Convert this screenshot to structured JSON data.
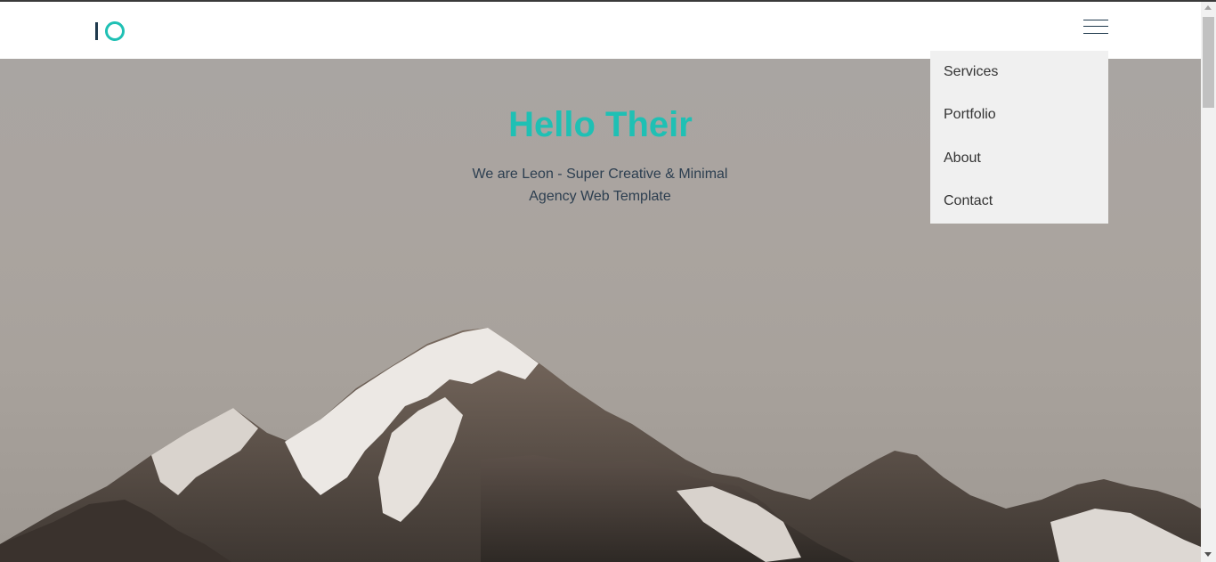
{
  "brand": {
    "logo_icon": "io-logo",
    "bar_color": "#1f3a4d",
    "ring_color": "#1fc0b4"
  },
  "nav": {
    "menu_icon": "hamburger-menu-icon",
    "items": [
      {
        "label": "Services"
      },
      {
        "label": "Portfolio"
      },
      {
        "label": "About"
      },
      {
        "label": "Contact"
      }
    ]
  },
  "hero": {
    "title": "Hello Their",
    "subtitle_line1": "We are Leon - Super Creative & Minimal",
    "subtitle_line2": "Agency Web Template",
    "accent_color": "#1fc0b4",
    "text_color": "#2c3e50"
  }
}
